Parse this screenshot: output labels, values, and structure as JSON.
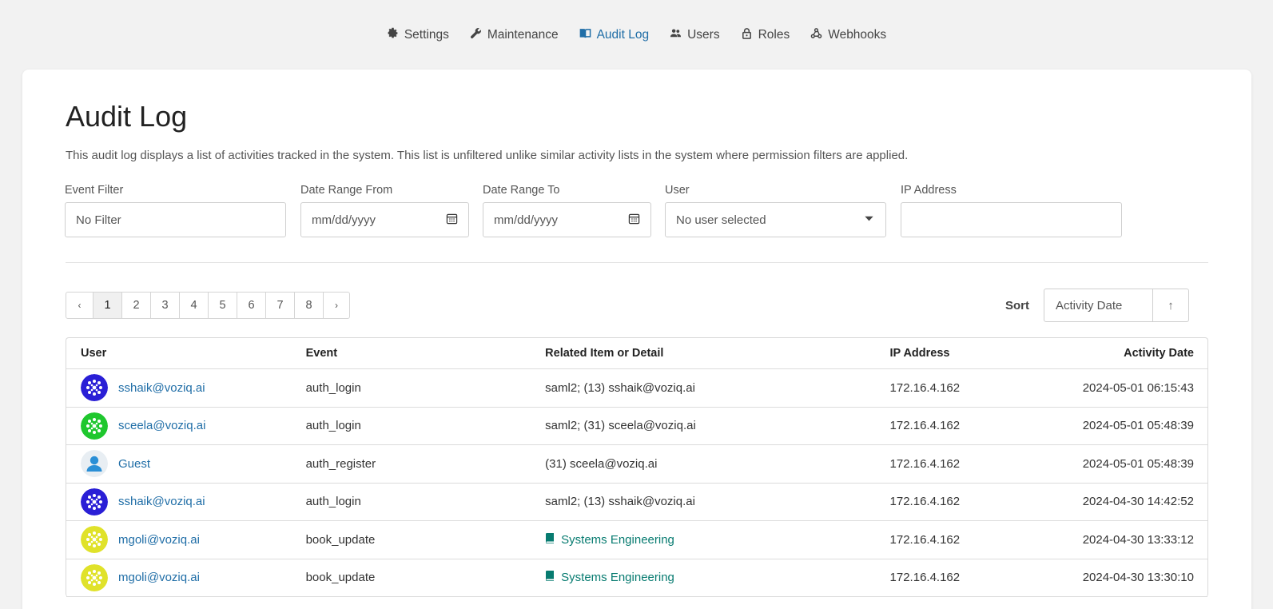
{
  "nav": [
    {
      "label": "Settings",
      "icon": "gear-icon",
      "active": false
    },
    {
      "label": "Maintenance",
      "icon": "wrench-icon",
      "active": false
    },
    {
      "label": "Audit Log",
      "icon": "book-open-icon",
      "active": true
    },
    {
      "label": "Users",
      "icon": "users-icon",
      "active": false
    },
    {
      "label": "Roles",
      "icon": "lock-icon",
      "active": false
    },
    {
      "label": "Webhooks",
      "icon": "webhook-icon",
      "active": false
    }
  ],
  "page": {
    "title": "Audit Log",
    "description": "This audit log displays a list of activities tracked in the system. This list is unfiltered unlike similar activity lists in the system where permission filters are applied."
  },
  "filters": {
    "event": {
      "label": "Event Filter",
      "value": "No Filter"
    },
    "date_from": {
      "label": "Date Range From",
      "placeholder": "mm/dd/yyyy"
    },
    "date_to": {
      "label": "Date Range To",
      "placeholder": "mm/dd/yyyy"
    },
    "user": {
      "label": "User",
      "value": "No user selected"
    },
    "ip": {
      "label": "IP Address",
      "value": ""
    }
  },
  "pagination": {
    "prev": "‹",
    "next": "›",
    "pages": [
      "1",
      "2",
      "3",
      "4",
      "5",
      "6",
      "7",
      "8"
    ],
    "current": "1"
  },
  "sort": {
    "label": "Sort",
    "value": "Activity Date",
    "direction": "↑"
  },
  "table": {
    "headers": {
      "user": "User",
      "event": "Event",
      "related": "Related Item or Detail",
      "ip": "IP Address",
      "date": "Activity Date"
    },
    "rows": [
      {
        "user": "sshaik@voziq.ai",
        "avatar_color": "#2a1fd6",
        "event": "auth_login",
        "related": "saml2; (13) sshaik@voziq.ai",
        "related_is_book": false,
        "ip": "172.16.4.162",
        "date": "2024-05-01 06:15:43"
      },
      {
        "user": "sceela@voziq.ai",
        "avatar_color": "#1fc72e",
        "event": "auth_login",
        "related": "saml2; (31) sceela@voziq.ai",
        "related_is_book": false,
        "ip": "172.16.4.162",
        "date": "2024-05-01 05:48:39"
      },
      {
        "user": "Guest",
        "avatar_color": "#2a8fd6",
        "event": "auth_register",
        "related": "(31) sceela@voziq.ai",
        "related_is_book": false,
        "ip": "172.16.4.162",
        "date": "2024-05-01 05:48:39"
      },
      {
        "user": "sshaik@voziq.ai",
        "avatar_color": "#2a1fd6",
        "event": "auth_login",
        "related": "saml2; (13) sshaik@voziq.ai",
        "related_is_book": false,
        "ip": "172.16.4.162",
        "date": "2024-04-30 14:42:52"
      },
      {
        "user": "mgoli@voziq.ai",
        "avatar_color": "#e0e22a",
        "event": "book_update",
        "related": "Systems Engineering",
        "related_is_book": true,
        "ip": "172.16.4.162",
        "date": "2024-04-30 13:33:12"
      },
      {
        "user": "mgoli@voziq.ai",
        "avatar_color": "#e0e22a",
        "event": "book_update",
        "related": "Systems Engineering",
        "related_is_book": true,
        "ip": "172.16.4.162",
        "date": "2024-04-30 13:30:10"
      }
    ]
  },
  "colors": {
    "accent": "#206ea7",
    "book": "#077b70"
  }
}
